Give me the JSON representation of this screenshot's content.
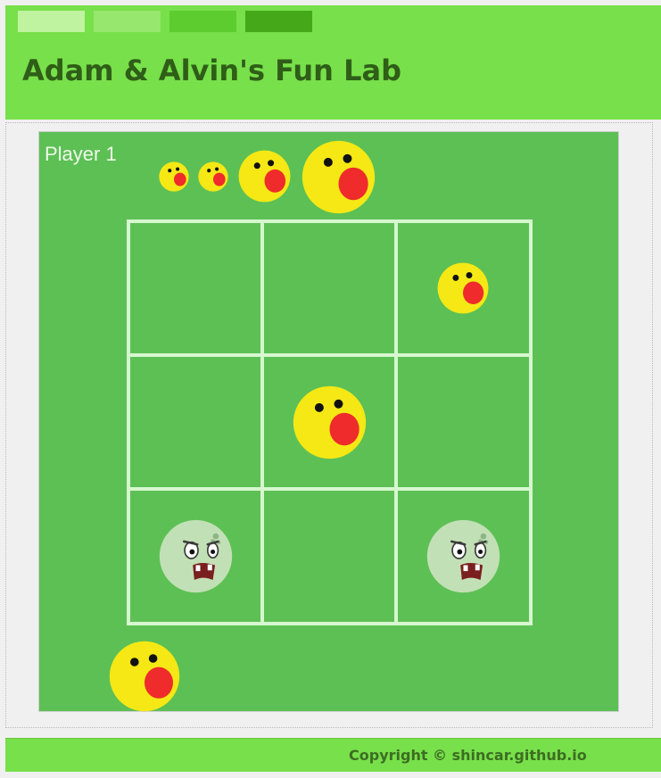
{
  "header": {
    "title": "Adam & Alvin's Fun Lab",
    "swatches": [
      "#bff39f",
      "#97e66e",
      "#5ccc2e",
      "#44a818"
    ]
  },
  "game": {
    "current_player_label": "Player 1",
    "board_rows": 3,
    "board_cols": 3,
    "player1_reserve": [
      {
        "piece": "yellow-face-icon",
        "size": "small"
      },
      {
        "piece": "yellow-face-icon",
        "size": "small"
      },
      {
        "piece": "yellow-face-icon",
        "size": "medium"
      },
      {
        "piece": "yellow-face-icon",
        "size": "large"
      }
    ],
    "player2_reserve": [
      {
        "piece": "yellow-face-icon",
        "size": "large"
      }
    ],
    "board": [
      [
        null,
        null,
        {
          "piece": "yellow-face-icon",
          "size": "medium"
        }
      ],
      [
        null,
        {
          "piece": "yellow-face-icon",
          "size": "large"
        },
        null
      ],
      [
        {
          "piece": "zombie-face-icon",
          "size": "large"
        },
        null,
        {
          "piece": "zombie-face-icon",
          "size": "large"
        }
      ]
    ]
  },
  "colors": {
    "header_bg": "#78e04a",
    "board_bg": "#5dc055",
    "grid_line": "#d6f7cf",
    "yellow_face": "#f5e815",
    "mouth_red": "#ef2b2b",
    "zombie_face": "#c2e0b6"
  },
  "footer": {
    "copyright": "Copyright © shincar.github.io"
  }
}
